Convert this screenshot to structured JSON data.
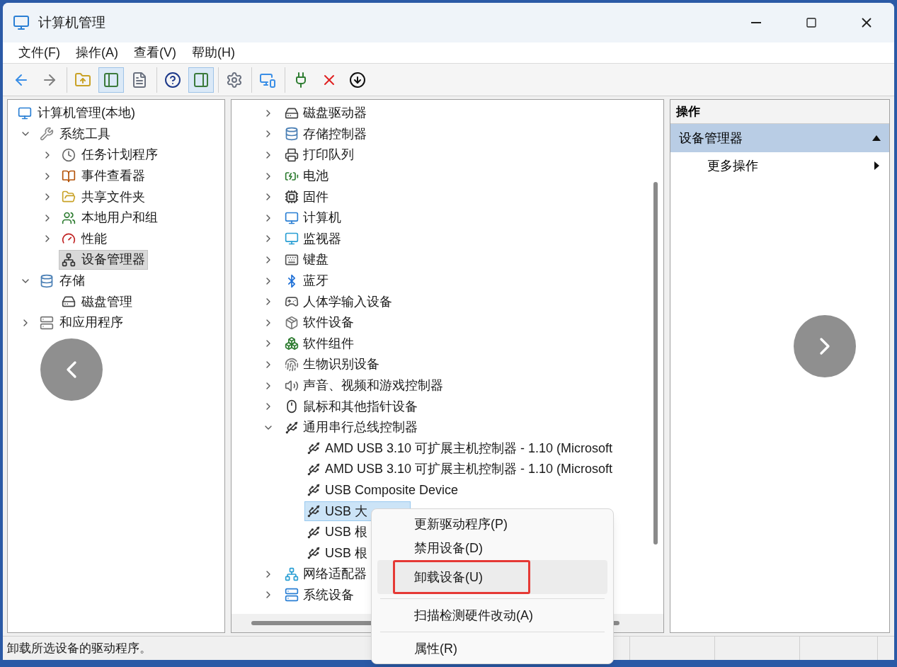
{
  "window": {
    "title": "计算机管理"
  },
  "menu_bar": [
    "文件(F)",
    "操作(A)",
    "查看(V)",
    "帮助(H)"
  ],
  "toolbar": [
    {
      "buttons": [
        {
          "kind": "back",
          "pressed": false
        },
        {
          "kind": "forward",
          "pressed": false
        }
      ]
    },
    {
      "buttons": [
        {
          "kind": "up",
          "pressed": false
        },
        {
          "kind": "tree",
          "pressed": true
        },
        {
          "kind": "properties",
          "pressed": false
        }
      ]
    },
    {
      "buttons": [
        {
          "kind": "help",
          "pressed": false
        },
        {
          "kind": "action_pane",
          "pressed": true
        }
      ]
    },
    {
      "buttons": [
        {
          "kind": "update",
          "pressed": false
        }
      ]
    },
    {
      "buttons": [
        {
          "kind": "scan",
          "pressed": false
        }
      ]
    },
    {
      "buttons": [
        {
          "kind": "enable",
          "pressed": false
        },
        {
          "kind": "delete",
          "pressed": false
        },
        {
          "kind": "download",
          "pressed": false
        }
      ]
    }
  ],
  "nav_tree": [
    {
      "label": "计算机管理(本地)",
      "kind": "computer",
      "selected": false,
      "children": [
        {
          "label": "系统工具",
          "kind": "tools",
          "expanded": true,
          "selected": false,
          "children": [
            {
              "label": "任务计划程序",
              "kind": "clock",
              "expanded": false,
              "selected": false
            },
            {
              "label": "事件查看器",
              "kind": "event",
              "expanded": false,
              "selected": false
            },
            {
              "label": "共享文件夹",
              "kind": "share",
              "expanded": false,
              "selected": false
            },
            {
              "label": "本地用户和组",
              "kind": "users",
              "expanded": false,
              "selected": false
            },
            {
              "label": "性能",
              "kind": "performance",
              "expanded": false,
              "selected": false
            },
            {
              "label": "设备管理器",
              "kind": "device",
              "selected": true
            }
          ]
        },
        {
          "label": "存储",
          "kind": "storage",
          "expanded": true,
          "selected": false,
          "children": [
            {
              "label": "磁盘管理",
              "kind": "disk",
              "selected": false
            }
          ]
        },
        {
          "label": "和应用程序",
          "kind": "services",
          "expanded": false,
          "selected": false
        }
      ]
    }
  ],
  "device_tree": [
    {
      "label": "磁盘驱动器",
      "kind": "disk",
      "expanded": false,
      "selected": false
    },
    {
      "label": "存储控制器",
      "kind": "storage",
      "expanded": false,
      "selected": false
    },
    {
      "label": "打印队列",
      "kind": "printer",
      "expanded": false,
      "selected": false
    },
    {
      "label": "电池",
      "kind": "battery",
      "expanded": false,
      "selected": false
    },
    {
      "label": "固件",
      "kind": "firmware",
      "expanded": false,
      "selected": false
    },
    {
      "label": "计算机",
      "kind": "computer",
      "expanded": false,
      "selected": false
    },
    {
      "label": "监视器",
      "kind": "monitor",
      "expanded": false,
      "selected": false
    },
    {
      "label": "键盘",
      "kind": "keyboard",
      "expanded": false,
      "selected": false
    },
    {
      "label": "蓝牙",
      "kind": "bluetooth",
      "expanded": false,
      "selected": false
    },
    {
      "label": "人体学输入设备",
      "kind": "hid",
      "expanded": false,
      "selected": false
    },
    {
      "label": "软件设备",
      "kind": "software",
      "expanded": false,
      "selected": false
    },
    {
      "label": "软件组件",
      "kind": "component",
      "expanded": false,
      "selected": false
    },
    {
      "label": "生物识别设备",
      "kind": "biometric",
      "expanded": false,
      "selected": false
    },
    {
      "label": "声音、视频和游戏控制器",
      "kind": "sound",
      "expanded": false,
      "selected": false
    },
    {
      "label": "鼠标和其他指针设备",
      "kind": "mouse",
      "expanded": false,
      "selected": false
    },
    {
      "label": "通用串行总线控制器",
      "kind": "usb",
      "expanded": true,
      "selected": false,
      "children": [
        {
          "label": "AMD USB 3.10 可扩展主机控制器 - 1.10 (Microsoft",
          "kind": "usb",
          "selected": false
        },
        {
          "label": "AMD USB 3.10 可扩展主机控制器 - 1.10 (Microsoft",
          "kind": "usb",
          "selected": false
        },
        {
          "label": "USB Composite Device",
          "kind": "usb",
          "selected": false
        },
        {
          "label": "USB 大",
          "kind": "usb",
          "selected": true
        },
        {
          "label": "USB 根",
          "kind": "usb",
          "selected": false
        },
        {
          "label": "USB 根",
          "kind": "usb",
          "selected": false
        }
      ]
    },
    {
      "label": "网络适配器",
      "kind": "network",
      "expanded": false,
      "selected": false
    },
    {
      "label": "系统设备",
      "kind": "system",
      "expanded": false,
      "selected": false
    }
  ],
  "actions_pane": {
    "header": "操作",
    "section": {
      "label": "设备管理器",
      "expanded": true,
      "items": [
        "更多操作"
      ]
    }
  },
  "context_menu": [
    {
      "kind": "item",
      "label": "更新驱动程序(P)",
      "selected": false,
      "highlighted": false
    },
    {
      "kind": "item",
      "label": "禁用设备(D)",
      "selected": false,
      "highlighted": false
    },
    {
      "kind": "item",
      "label": "卸载设备(U)",
      "selected": true,
      "highlighted": true
    },
    {
      "kind": "separator"
    },
    {
      "kind": "item",
      "label": "扫描检测硬件改动(A)",
      "selected": false,
      "highlighted": false
    },
    {
      "kind": "separator"
    },
    {
      "kind": "item",
      "label": "属性(R)",
      "selected": false,
      "highlighted": false
    }
  ],
  "status_bar": {
    "text": "卸载所选设备的驱动程序。"
  }
}
